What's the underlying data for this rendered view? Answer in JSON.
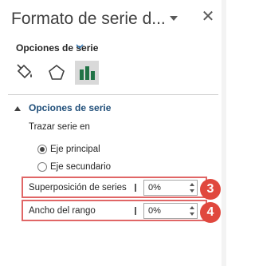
{
  "pane": {
    "title": "Formato de serie d...",
    "close_icon": "close-icon"
  },
  "tab_row": {
    "label": "Opciones de serie"
  },
  "icons": [
    "fill-line-icon",
    "effects-pentagon-icon",
    "series-options-icon"
  ],
  "section": {
    "title": "Opciones de serie",
    "plot_on_label": "Trazar serie en",
    "radio_primary": "Eje principal",
    "radio_secondary": "Eje secundario",
    "primary_selected": true
  },
  "overlap": {
    "label": "Superposición de series",
    "value": "0%",
    "badge": "3"
  },
  "gap_width": {
    "label": "Ancho del rango",
    "value": "0%",
    "badge": "4"
  },
  "colors": {
    "accent": "#e0483e",
    "section_title": "#1f4e79",
    "selected_icon_bg": "#d9d9d9"
  }
}
